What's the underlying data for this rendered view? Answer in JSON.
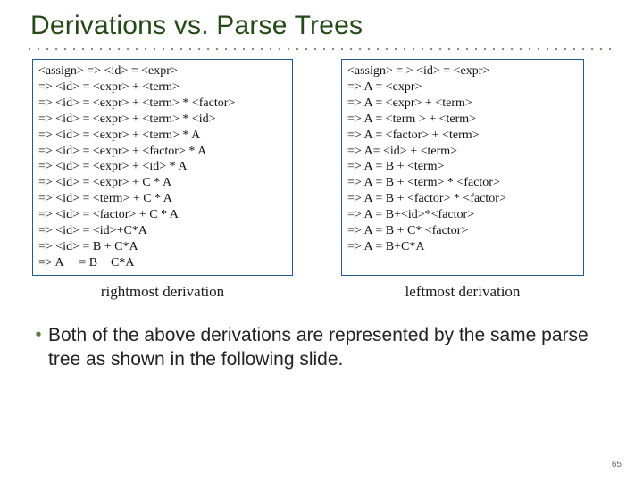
{
  "title": "Derivations vs. Parse Trees",
  "leftDerivation": [
    "<assign> => <id> = <expr>",
    "=> <id> = <expr> + <term>",
    "=> <id> = <expr> + <term> * <factor>",
    "=> <id> = <expr> + <term> * <id>",
    "=> <id> = <expr> + <term> * A",
    "=> <id> = <expr> + <factor> * A",
    "=> <id> = <expr> + <id> * A",
    "=> <id> = <expr> + C * A",
    "=> <id> = <term> + C * A",
    "=> <id> = <factor> + C * A",
    "=> <id> = <id>+C*A",
    "=> <id> = B + C*A",
    "=> A     = B + C*A"
  ],
  "rightDerivation": [
    "<assign> = > <id> = <expr>",
    "=> A = <expr>",
    "=> A = <expr> + <term>",
    "=> A = <term > + <term>",
    "=> A = <factor> + <term>",
    "=> A= <id> + <term>",
    "=> A = B + <term>",
    "=> A = B + <term> * <factor>",
    "=> A = B + <factor> * <factor>",
    "=> A = B+<id>*<factor>",
    "=> A = B + C* <factor>",
    "=> A = B+C*A"
  ],
  "leftCaption": "rightmost derivation",
  "rightCaption": "leftmost derivation",
  "bulletText": "Both of the above derivations are represented by the same parse tree as shown in the following slide.",
  "pageNumber": "65"
}
